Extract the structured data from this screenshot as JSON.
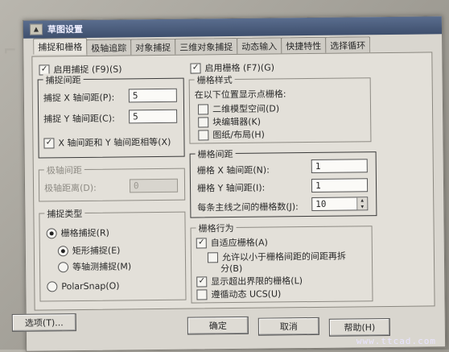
{
  "window": {
    "title": "草图设置"
  },
  "tabs": [
    {
      "label": "捕捉和栅格",
      "active": true
    },
    {
      "label": "极轴追踪"
    },
    {
      "label": "对象捕捉"
    },
    {
      "label": "三维对象捕捉"
    },
    {
      "label": "动态输入"
    },
    {
      "label": "快捷特性"
    },
    {
      "label": "选择循环"
    }
  ],
  "snap": {
    "enable_label": "启用捕捉 (F9)(S)",
    "enabled": true,
    "spacing_group": "捕捉间距",
    "x_label": "捕捉 X 轴间距(P):",
    "x_value": "5",
    "y_label": "捕捉 Y 轴间距(C):",
    "y_value": "5",
    "equal_label": "X 轴间距和 Y 轴间距相等(X)",
    "equal_checked": true
  },
  "polar": {
    "group": "极轴间距",
    "distance_label": "极轴距离(D):",
    "distance_value": "0"
  },
  "snap_type": {
    "group": "捕捉类型",
    "grid_snap": "栅格捕捉(R)",
    "rect_snap": "矩形捕捉(E)",
    "iso_snap": "等轴测捕捉(M)",
    "polar_snap": "PolarSnap(O)"
  },
  "grid": {
    "enable_label": "启用栅格 (F7)(G)",
    "enabled": true,
    "style_group": "栅格样式",
    "style_caption": "在以下位置显示点栅格:",
    "style_2d": "二维模型空间(D)",
    "style_block": "块编辑器(K)",
    "style_sheet": "图纸/布局(H)",
    "spacing_group": "栅格间距",
    "x_label": "栅格 X 轴间距(N):",
    "x_value": "1",
    "y_label": "栅格 Y 轴间距(I):",
    "y_value": "1",
    "major_label": "每条主线之间的栅格数(J):",
    "major_value": "10",
    "behavior_group": "栅格行为",
    "adaptive_label": "自适应栅格(A)",
    "adaptive_checked": true,
    "subdivide_label_1": "允许以小于栅格间距的间距再拆",
    "subdivide_label_2": "分(B)",
    "beyond_label": "显示超出界限的栅格(L)",
    "beyond_checked": true,
    "ucs_label": "遵循动态 UCS(U)"
  },
  "buttons": {
    "options": "选项(T)...",
    "ok": "确定",
    "cancel": "取消",
    "help": "帮助(H)"
  },
  "watermark": "www.ttcad.com"
}
